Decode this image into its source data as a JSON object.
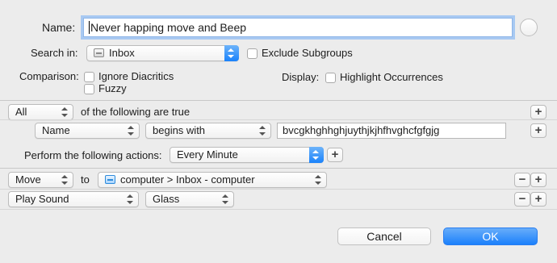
{
  "header": {
    "name_label": "Name:",
    "name_value": "Never happing move and Beep",
    "help_label": "?",
    "search_in_label": "Search in:",
    "search_in_value": "Inbox",
    "exclude_subgroups": "Exclude Subgroups",
    "comparison_label": "Comparison:",
    "ignore_diacritics": "Ignore Diacritics",
    "fuzzy": "Fuzzy",
    "display_label": "Display:",
    "highlight_occurrences": "Highlight Occurrences"
  },
  "conditions": {
    "match_value": "All",
    "match_suffix": "of the following are true",
    "rule": {
      "field": "Name",
      "operator": "begins with",
      "value": "bvcgkhghhghjuythjkjhfhvghcfgfgjg"
    }
  },
  "actions": {
    "perform_label": "Perform the following actions:",
    "schedule_value": "Every Minute",
    "items": [
      {
        "action": "Move",
        "connector": "to",
        "target": "computer > Inbox - computer"
      },
      {
        "action": "Play Sound",
        "target": "Glass"
      }
    ]
  },
  "buttons": {
    "add": "+",
    "remove": "−",
    "cancel": "Cancel",
    "ok": "OK"
  },
  "colors": {
    "accent": "#1b80fb",
    "background": "#ececec"
  }
}
